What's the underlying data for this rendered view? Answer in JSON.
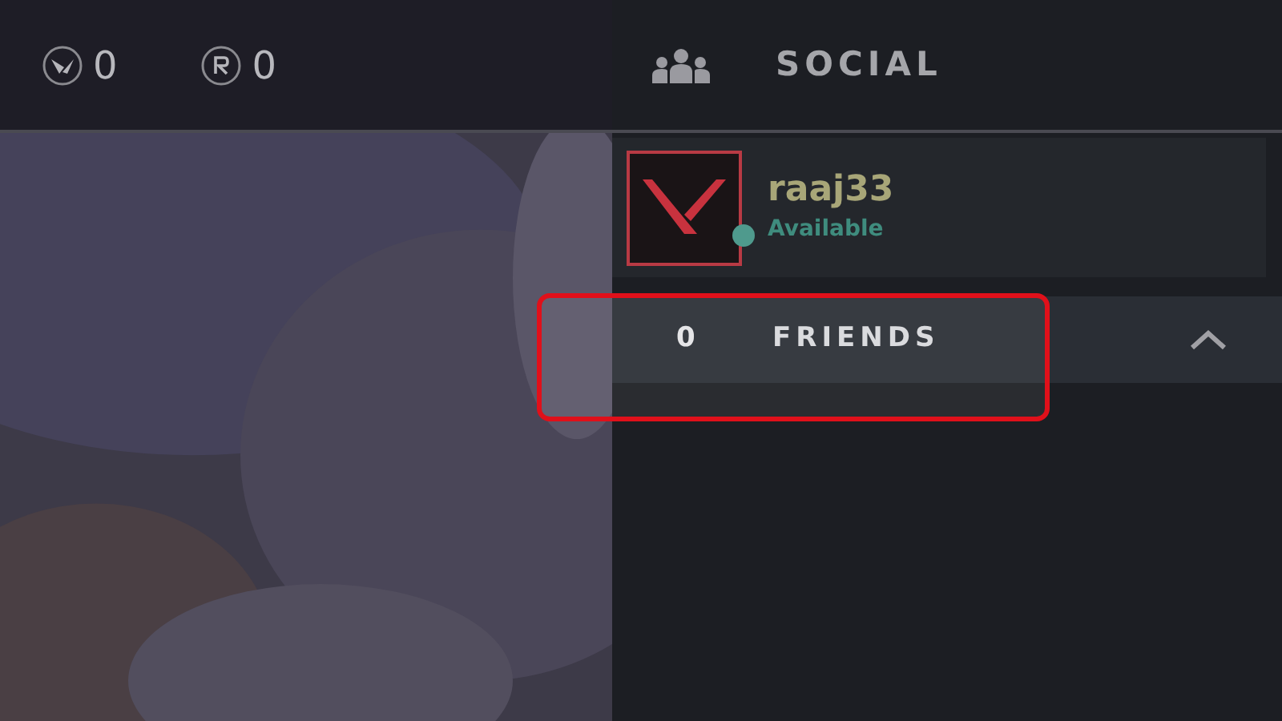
{
  "currencies": [
    {
      "kind": "valorant",
      "amount": "0"
    },
    {
      "kind": "radianite",
      "amount": "0"
    }
  ],
  "social": {
    "title": "SOCIAL"
  },
  "profile": {
    "name": "raaj33",
    "status": "Available",
    "online": true
  },
  "friends": {
    "count": "0",
    "label": "FRIENDS",
    "expanded": true
  }
}
